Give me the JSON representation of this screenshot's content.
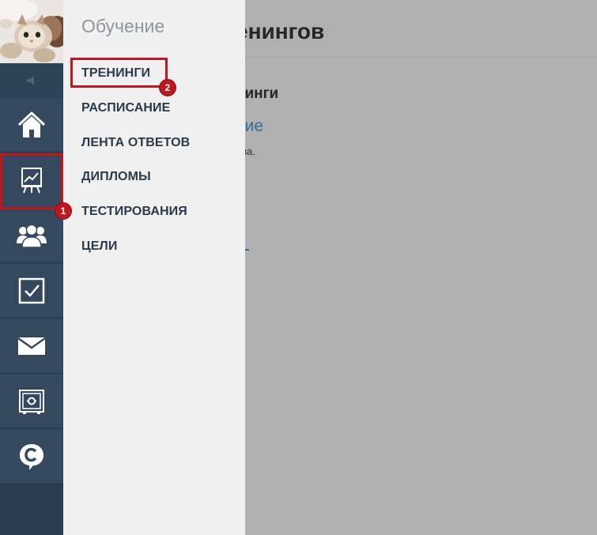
{
  "submenu": {
    "title": "Обучение",
    "items": [
      {
        "label": "ТРЕНИНГИ"
      },
      {
        "label": "РАСПИСАНИЕ"
      },
      {
        "label": "ЛЕНТА ОТВЕТОВ"
      },
      {
        "label": "ДИПЛОМЫ"
      },
      {
        "label": "ТЕСТИРОВАНИЯ"
      },
      {
        "label": "ЦЕЛИ"
      }
    ]
  },
  "rail": {
    "icons": [
      "speaker-icon",
      "home-icon",
      "training-chart-icon",
      "people-icon",
      "checkbox-icon",
      "mail-icon",
      "safe-icon",
      "coin-icon"
    ]
  },
  "background_page": {
    "heading": "енингов",
    "subheading": "нинги",
    "link": "ние",
    "small_text": "ова."
  },
  "annotations": {
    "badge_1": "1",
    "badge_2": "2",
    "color": "#c0171f"
  },
  "colors": {
    "rail": "#34495e",
    "submenu_bg": "#f0f0f0",
    "overlay": "#b0b0b0"
  }
}
